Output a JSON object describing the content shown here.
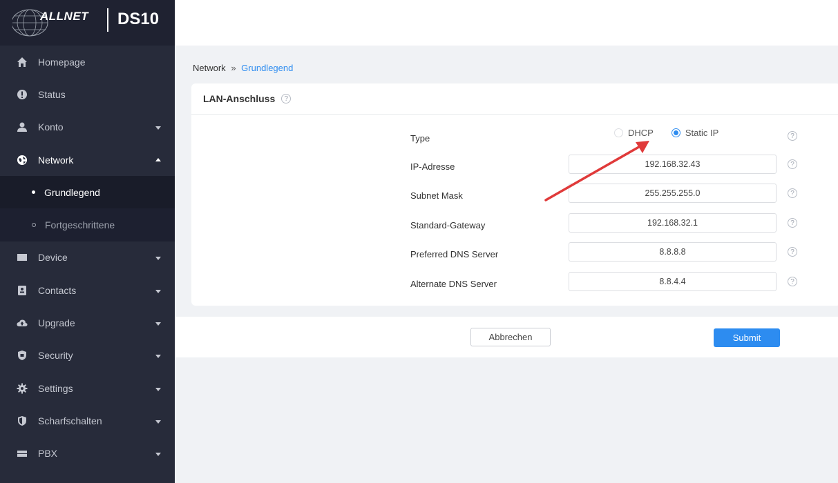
{
  "brand": {
    "name": "ALLNET",
    "model": "DS10"
  },
  "sidebar": {
    "items": [
      {
        "label": "Homepage",
        "icon": "home-icon"
      },
      {
        "label": "Status",
        "icon": "alert-icon"
      },
      {
        "label": "Konto",
        "icon": "user-icon"
      },
      {
        "label": "Network",
        "icon": "network-icon"
      },
      {
        "label": "Device",
        "icon": "monitor-icon"
      },
      {
        "label": "Contacts",
        "icon": "contacts-icon"
      },
      {
        "label": "Upgrade",
        "icon": "cloud-upload-icon"
      },
      {
        "label": "Security",
        "icon": "shield-icon"
      },
      {
        "label": "Settings",
        "icon": "gear-icon"
      },
      {
        "label": "Scharfschalten",
        "icon": "shield-check-icon"
      },
      {
        "label": "PBX",
        "icon": "pbx-icon"
      }
    ],
    "network_sub": [
      {
        "label": "Grundlegend"
      },
      {
        "label": "Fortgeschrittene"
      }
    ]
  },
  "breadcrumb": {
    "parent": "Network",
    "separator": "»",
    "current": "Grundlegend"
  },
  "card": {
    "title": "LAN-Anschluss"
  },
  "form": {
    "type": {
      "label": "Type",
      "options": [
        "DHCP",
        "Static IP"
      ],
      "selected": "Static IP"
    },
    "ip": {
      "label": "IP-Adresse",
      "value": "192.168.32.43"
    },
    "subnet": {
      "label": "Subnet Mask",
      "value": "255.255.255.0"
    },
    "gateway": {
      "label": "Standard-Gateway",
      "value": "192.168.32.1"
    },
    "dns1": {
      "label": "Preferred DNS Server",
      "value": "8.8.8.8"
    },
    "dns2": {
      "label": "Alternate DNS Server",
      "value": "8.8.4.4"
    }
  },
  "help_glyph": "?",
  "buttons": {
    "cancel": "Abbrechen",
    "submit": "Submit"
  },
  "colors": {
    "accent": "#2d8cf0",
    "sidebar": "#272b3a",
    "annotation_arrow": "#e03a3a"
  }
}
